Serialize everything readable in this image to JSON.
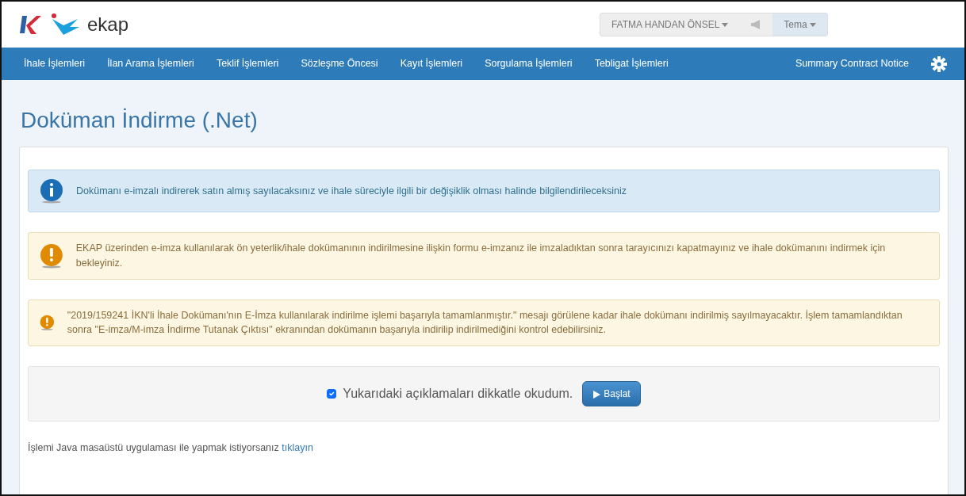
{
  "header": {
    "logo_text": "ekap",
    "user_menu": "FATMA HANDAN ÖNSEL",
    "theme_menu": "Tema"
  },
  "nav": {
    "items": [
      {
        "label": "İhale İşlemleri"
      },
      {
        "label": "İlan Arama İşlemleri"
      },
      {
        "label": "Teklif İşlemleri"
      },
      {
        "label": "Sözleşme Öncesi"
      },
      {
        "label": "Kayıt İşlemleri"
      },
      {
        "label": "Sorgulama İşlemleri"
      },
      {
        "label": "Tebligat İşlemleri"
      }
    ],
    "right_item": "Summary Contract Notice"
  },
  "page_title": "Doküman İndirme (.Net)",
  "alerts": [
    {
      "kind": "info",
      "text": "Dokümanı e-imzalı indirerek satın almış sayılacaksınız ve ihale süreciyle ilgili bir değişiklik olması halinde bilgilendirileceksiniz"
    },
    {
      "kind": "warning",
      "text": "EKAP üzerinden e-imza kullanılarak ön yeterlik/ihale dokümanının indirilmesine ilişkin formu e-imzanız ile imzaladıktan sonra tarayıcınızı kapatmayınız ve ihale dokümanını indirmek için bekleyiniz."
    },
    {
      "kind": "warning",
      "text": "\"2019/159241 İKN'li İhale Dokümanı'nın E-İmza kullanılarak indirilme işlemi başarıyla tamamlanmıştır.\" mesajı görülene kadar ihale dokümanı indirilmiş sayılmayacaktır. İşlem tamamlandıktan sonra \"E-imza/M-imza İndirme Tutanak Çıktısı\" ekranından dokümanın başarıyla indirilip indirilmediğini kontrol edebilirsiniz."
    }
  ],
  "confirm": {
    "checkbox_label": "Yukarıdaki açıklamaları dikkatle okudum.",
    "checked": true,
    "button": "Başlat"
  },
  "java_note": {
    "text": "İşlemi Java masaüstü uygulaması ile yapmak istiyorsanız",
    "link": "tıklayın"
  }
}
